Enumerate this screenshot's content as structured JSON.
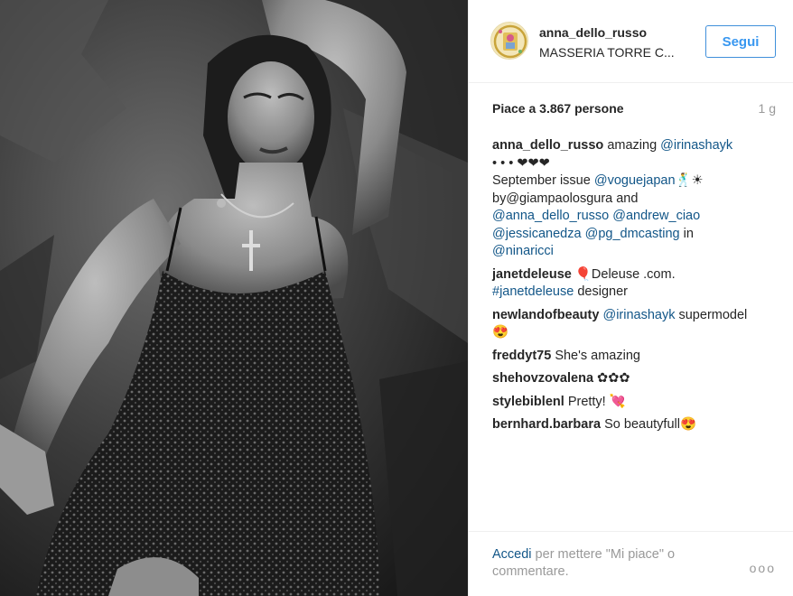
{
  "post": {
    "username": "anna_dello_russo",
    "location": "MASSERIA TORRE C...",
    "follow_label": "Segui",
    "likes": "Piace a 3.867 persone",
    "time": "1 g"
  },
  "caption": {
    "author": "anna_dello_russo",
    "line1": "amazing ",
    "mention1": "@irinashayk",
    "line2": "• • • ❤❤❤",
    "line3": "September issue ",
    "mention2": "@voguejapan",
    "line3_end": "🕺☀",
    "line4": "by@giampaolosgura and",
    "mention3": "@anna_dello_russo",
    "mention4": "@andrew_ciao",
    "mention5": "@jessicanedza",
    "mention6": "@pg_dmcasting",
    "line6_end": " in",
    "mention7": "@ninaricci"
  },
  "comments": [
    {
      "author": "janetdeleuse",
      "text": "🎈Deleuse .com.",
      "hashtag": "#janetdeleuse",
      "text2": " designer"
    },
    {
      "author": "newlandofbeauty",
      "mention": "@irinashayk",
      "text": " supermodel",
      "text2": "😍"
    },
    {
      "author": "freddyt75",
      "text": "She's amazing"
    },
    {
      "author": "shehovzovalena",
      "text": "✿✿✿"
    },
    {
      "author": "stylebiblenl",
      "text": "Pretty! 💘"
    },
    {
      "author": "bernhard.barbara",
      "text": "So beautyfull😍"
    }
  ],
  "footer": {
    "login": "Accedi",
    "rest": " per mettere \"Mi piace\" o commentare.",
    "more": "ooo"
  },
  "icons": {
    "more": "more-options-icon",
    "avatar": "profile-avatar"
  }
}
